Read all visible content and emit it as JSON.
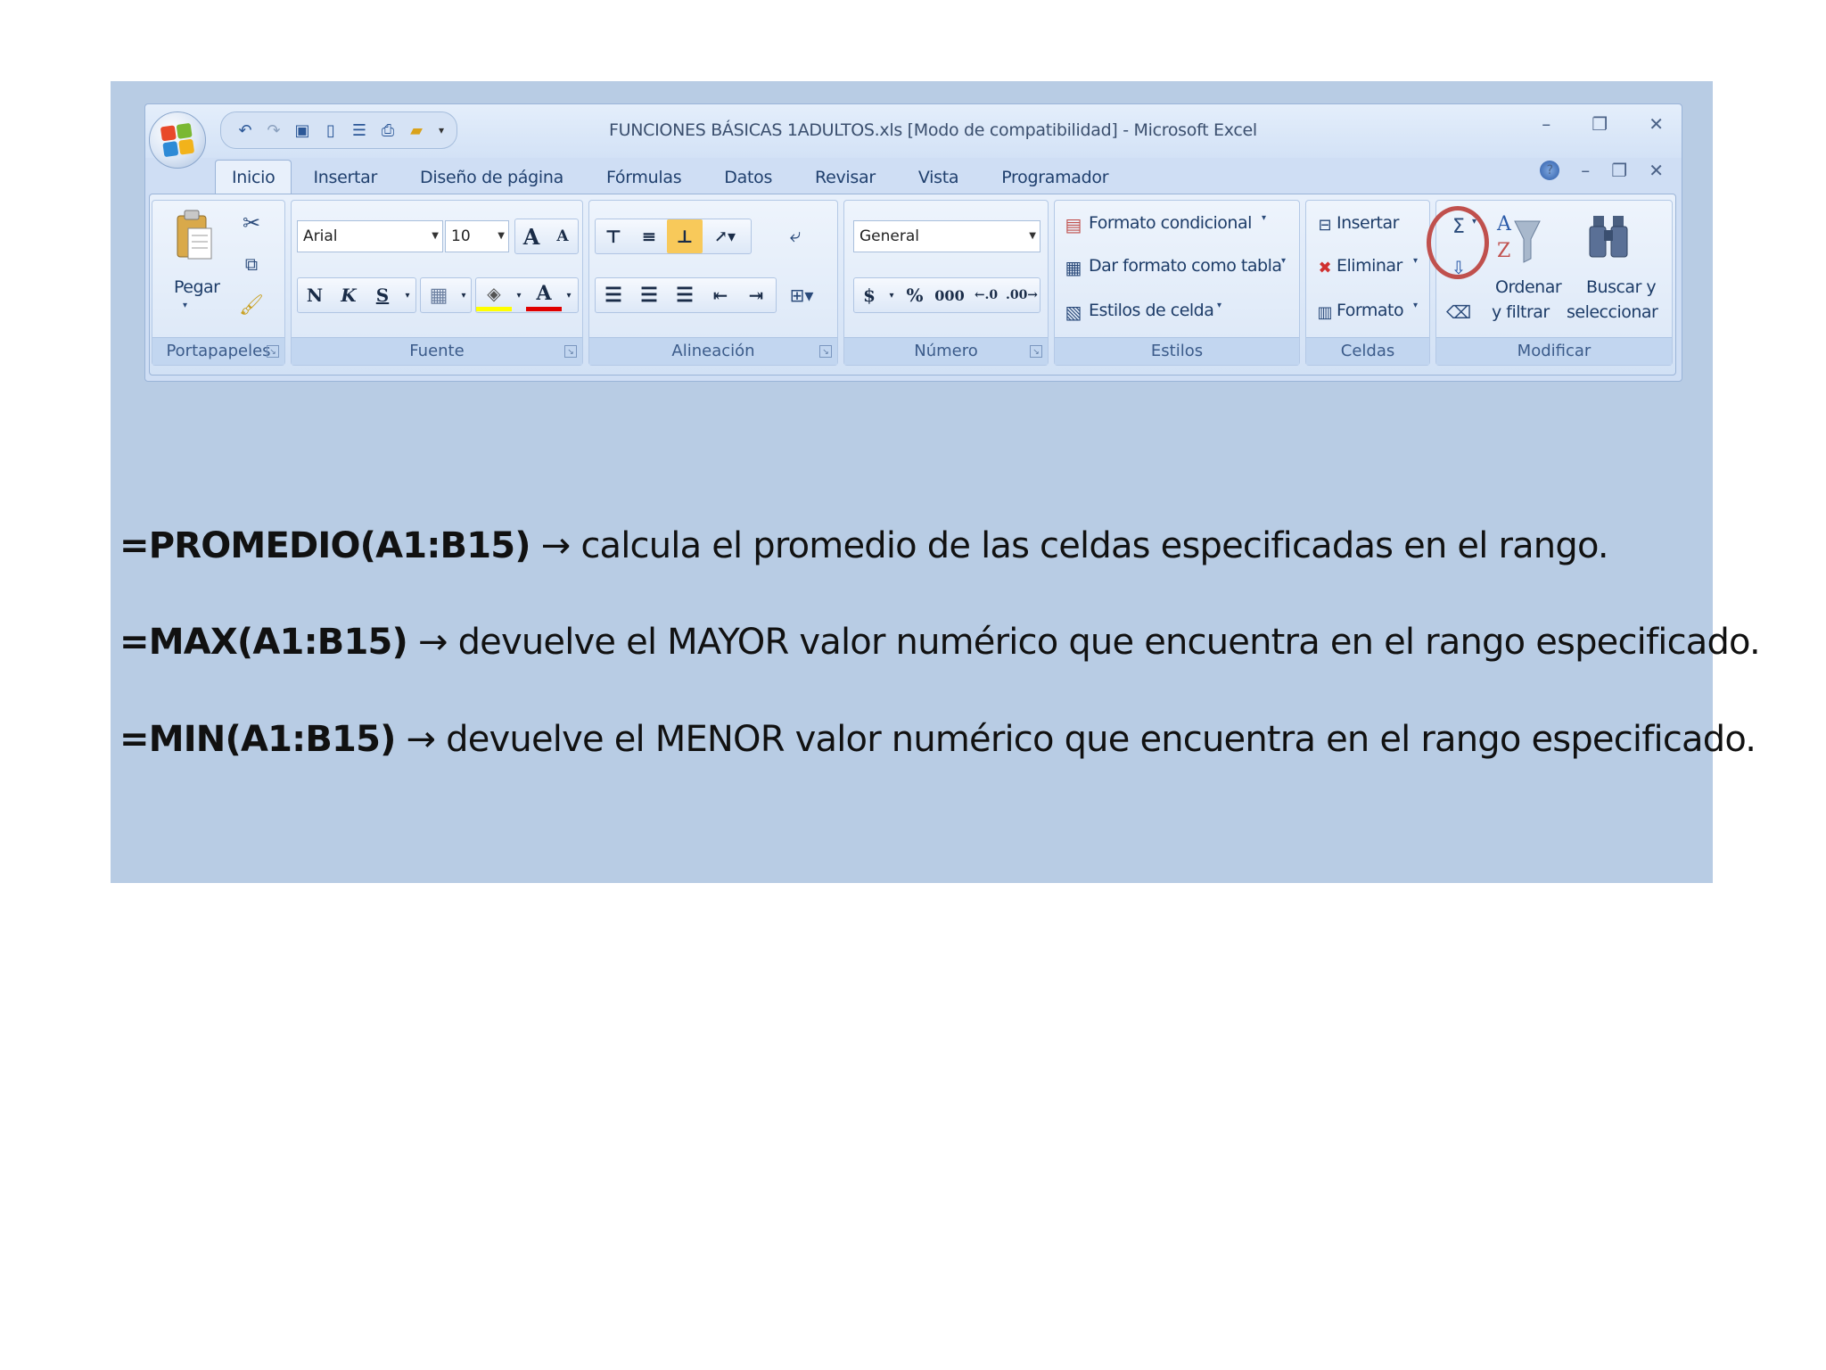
{
  "window": {
    "title": "FUNCIONES BÁSICAS 1ADULTOS.xls  [Modo de compatibilidad] - Microsoft Excel"
  },
  "quick_access": [
    "undo-icon",
    "redo-icon",
    "save-icon",
    "new-document-icon",
    "print-preview-icon",
    "print-icon",
    "open-folder-icon"
  ],
  "tabs": [
    "Inicio",
    "Insertar",
    "Diseño de página",
    "Fórmulas",
    "Datos",
    "Revisar",
    "Vista",
    "Programador"
  ],
  "ribbon": {
    "portapapeles": {
      "label": "Portapapeles",
      "paste": "Pegar"
    },
    "fuente": {
      "label": "Fuente",
      "font": "Arial",
      "size": "10",
      "bold": "N",
      "italic": "K",
      "underline": "S",
      "grow": "A",
      "shrink": "A",
      "font_color_letter": "A"
    },
    "alineacion": {
      "label": "Alineación"
    },
    "numero": {
      "label": "Número",
      "format": "General",
      "currency": "$",
      "percent": "%",
      "thousands": "000"
    },
    "estilos": {
      "label": "Estilos",
      "conditional": "Formato condicional",
      "as_table": "Dar formato como tabla",
      "cell_styles": "Estilos de celda"
    },
    "celdas": {
      "label": "Celdas",
      "insert": "Insertar",
      "delete": "Eliminar",
      "format": "Formato"
    },
    "modificar": {
      "label": "Modificar",
      "sort_1": "Ordenar",
      "sort_2": "y filtrar",
      "find_1": "Buscar y",
      "find_2": "seleccionar",
      "sum": "Σ"
    }
  },
  "formulas": [
    {
      "fn": "=PROMEDIO(A1:B15)",
      "desc": "calcula el promedio de las celdas especificadas en el rango."
    },
    {
      "fn": "=MAX(A1:B15)",
      "desc": "devuelve el MAYOR valor numérico que encuentra en el rango especificado."
    },
    {
      "fn": "=MIN(A1:B15)",
      "desc": "devuelve el MENOR valor numérico que encuentra en el rango especificado."
    }
  ],
  "arrow": "→",
  "colors": {
    "slide_bg": "#b8cce4",
    "highlight": "#c0504d"
  }
}
